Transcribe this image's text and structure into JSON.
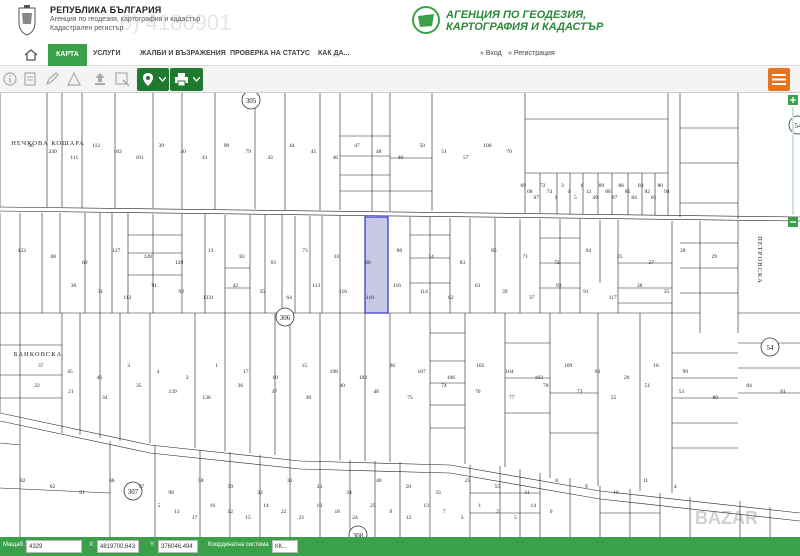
{
  "header": {
    "republic": "РЕПУБЛИКА БЪЛГАРИЯ",
    "line1": "Агенция по геодезия, картография и кадастър",
    "line2": "Кадастрален регистър",
    "watermark": "0) 4186901",
    "agency_line1": "АГЕНЦИЯ ПО ГЕОДЕЗИЯ,",
    "agency_line2": "КАРТОГРАФИЯ И КАДАСТЪР",
    "accent": "#3aa14a"
  },
  "nav": {
    "items": [
      "КАРТА",
      "УСЛУГИ",
      "ЖАЛБИ И ВЪЗРАЖЕНИЯ",
      "ПРОВЕРКА НА СТАТУС",
      "КАК ДА..."
    ],
    "login": "» Вход",
    "register": "» Регистрация"
  },
  "toolbar": {
    "icons": [
      "info-icon",
      "document-icon",
      "draw-icon",
      "measure-icon",
      "upload-icon",
      "select-icon"
    ],
    "location_icon": "location-pin-icon",
    "print_icon": "printer-icon",
    "menu_icon": "menu-icon"
  },
  "map": {
    "street_labels": [
      "НЕЧКОВА КОШАРА",
      "БАНКОВСКА",
      "ПЕТРОВСКА"
    ],
    "circle_labels": [
      "305",
      "306",
      "307",
      "308",
      "54",
      "54"
    ],
    "highlighted_parcel": "30",
    "parcel_labels": [
      "36",
      "230",
      "111",
      "112",
      "102",
      "101",
      "39",
      "40",
      "41",
      "90",
      "79",
      "43",
      "44",
      "45",
      "46",
      "47",
      "48",
      "40",
      "50",
      "51",
      "57",
      "100",
      "70",
      "69",
      "68",
      "67",
      "72",
      "74",
      "1",
      "3",
      "4",
      "5",
      "6",
      "12",
      "49",
      "89",
      "88",
      "87",
      "86",
      "85",
      "84",
      "83",
      "82",
      "81",
      "80",
      "94",
      "133",
      "68",
      "69",
      "127",
      "128",
      "129",
      "13",
      "82",
      "81",
      "73",
      "33",
      "88",
      "80",
      "14",
      "83",
      "85",
      "71",
      "72",
      "94",
      "25",
      "27",
      "28",
      "29",
      "30",
      "31",
      "112",
      "91",
      "92",
      "1331",
      "42",
      "35",
      "64",
      "113",
      "116",
      "118",
      "116",
      "114",
      "62",
      "61",
      "39",
      "37",
      "93",
      "91",
      "117",
      "38",
      "35",
      "37",
      "45",
      "46",
      "3",
      "4",
      "2",
      "1",
      "17",
      "10",
      "15",
      "108",
      "102",
      "96",
      "107",
      "106",
      "105",
      "104",
      "103",
      "109",
      "93",
      "20",
      "16",
      "99",
      "22",
      "21",
      "34",
      "35",
      "139",
      "136",
      "36",
      "37",
      "38",
      "40",
      "48",
      "75",
      "74",
      "76",
      "77",
      "78",
      "73",
      "55",
      "51",
      "53",
      "80",
      "84",
      "81",
      "82",
      "62",
      "61",
      "66",
      "97",
      "98",
      "58",
      "59",
      "32",
      "31",
      "33",
      "34",
      "40",
      "50",
      "33",
      "25",
      "55",
      "31",
      "8",
      "9",
      "10",
      "11",
      "4",
      "5",
      "13",
      "17",
      "16",
      "12",
      "15",
      "14",
      "22",
      "21",
      "19",
      "18",
      "24",
      "25",
      "8",
      "12",
      "13",
      "7",
      "3",
      "1",
      "2",
      "5",
      "14",
      "6"
    ]
  },
  "status": {
    "scale_label": "Мащаб 1:",
    "scale_value": "4329",
    "x_label": "X:",
    "x_value": "4819700,643",
    "y_label": "Y:",
    "y_value": "376046,494",
    "system_label": "Координатна система",
    "system_value": "КК..."
  },
  "watermark_bottom": "BAZAR"
}
